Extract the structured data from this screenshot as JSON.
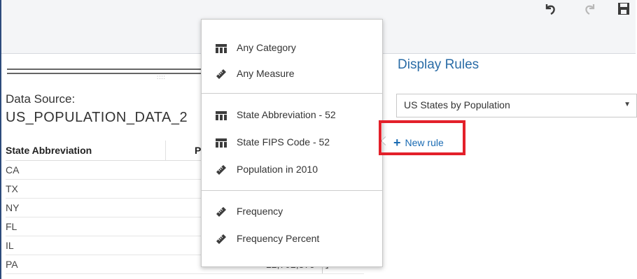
{
  "toolbar": {
    "icons": [
      "undo-icon",
      "redo-icon",
      "save-icon"
    ]
  },
  "data_source": {
    "label": "Data Source:",
    "name": "US_POPULATION_DATA_2"
  },
  "table": {
    "headers": [
      "State Abbreviation",
      "P"
    ],
    "rows": [
      {
        "state": "CA",
        "value": ""
      },
      {
        "state": "TX",
        "value": ""
      },
      {
        "state": "NY",
        "value": ""
      },
      {
        "state": "FL",
        "value": ""
      },
      {
        "state": "IL",
        "value": ""
      },
      {
        "state": "PA",
        "value": "12,702,379"
      }
    ]
  },
  "popup_menu": {
    "items": [
      {
        "label": "Any Category",
        "icon": "category-icon"
      },
      {
        "label": "Any Measure",
        "icon": "measure-icon"
      },
      {
        "label": "State Abbreviation - 52",
        "icon": "category-icon"
      },
      {
        "label": "State FIPS Code - 52",
        "icon": "category-icon"
      },
      {
        "label": "Population in 2010",
        "icon": "measure-icon"
      },
      {
        "label": "Frequency",
        "icon": "measure-icon"
      },
      {
        "label": "Frequency Percent",
        "icon": "measure-icon"
      }
    ]
  },
  "display_rules": {
    "title": "Display Rules",
    "dropdown_value": "US States by Population",
    "new_rule_label": "New rule"
  },
  "colors": {
    "accent_blue": "#1a6bb3",
    "highlight_red": "#e3202a",
    "title_blue": "#2a6ca6"
  }
}
